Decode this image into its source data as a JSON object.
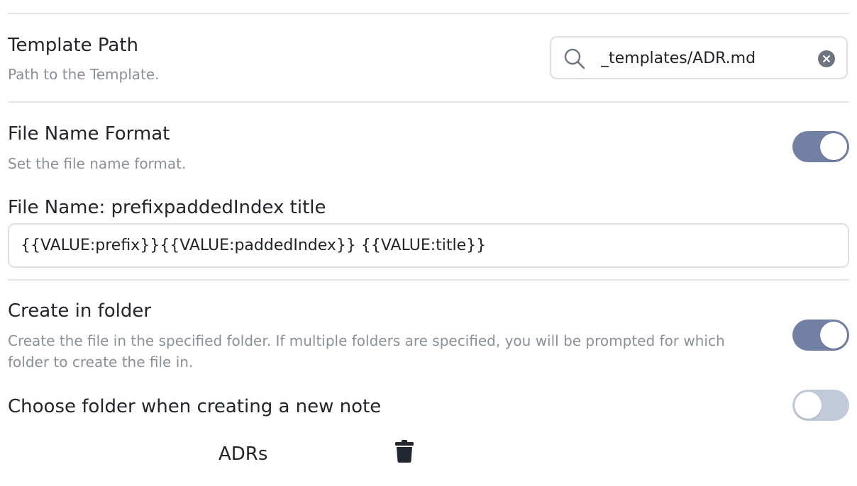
{
  "template_path": {
    "title": "Template Path",
    "description": "Path to the Template.",
    "input_value": "_templates/ADR.md",
    "icons": {
      "search": "search-icon",
      "clear": "clear-icon"
    }
  },
  "file_name_format": {
    "title": "File Name Format",
    "description": "Set the file name format.",
    "enabled": true,
    "preview_label": "File Name: prefixpaddedIndex title",
    "format_value": "{{VALUE:prefix}}{{VALUE:paddedIndex}} {{VALUE:title}}"
  },
  "create_in_folder": {
    "title": "Create in folder",
    "description": "Create the file in the specified folder. If multiple folders are specified, you will be prompted for which folder to create the file in.",
    "enabled": true
  },
  "choose_folder": {
    "title": "Choose folder when creating a new note",
    "enabled": false
  },
  "folders": [
    {
      "name": "ADRs",
      "icon": "trash-icon"
    }
  ],
  "colors": {
    "toggle_on": "#7281a3",
    "toggle_off": "#c1cad8",
    "description_text": "#8a8f98"
  }
}
